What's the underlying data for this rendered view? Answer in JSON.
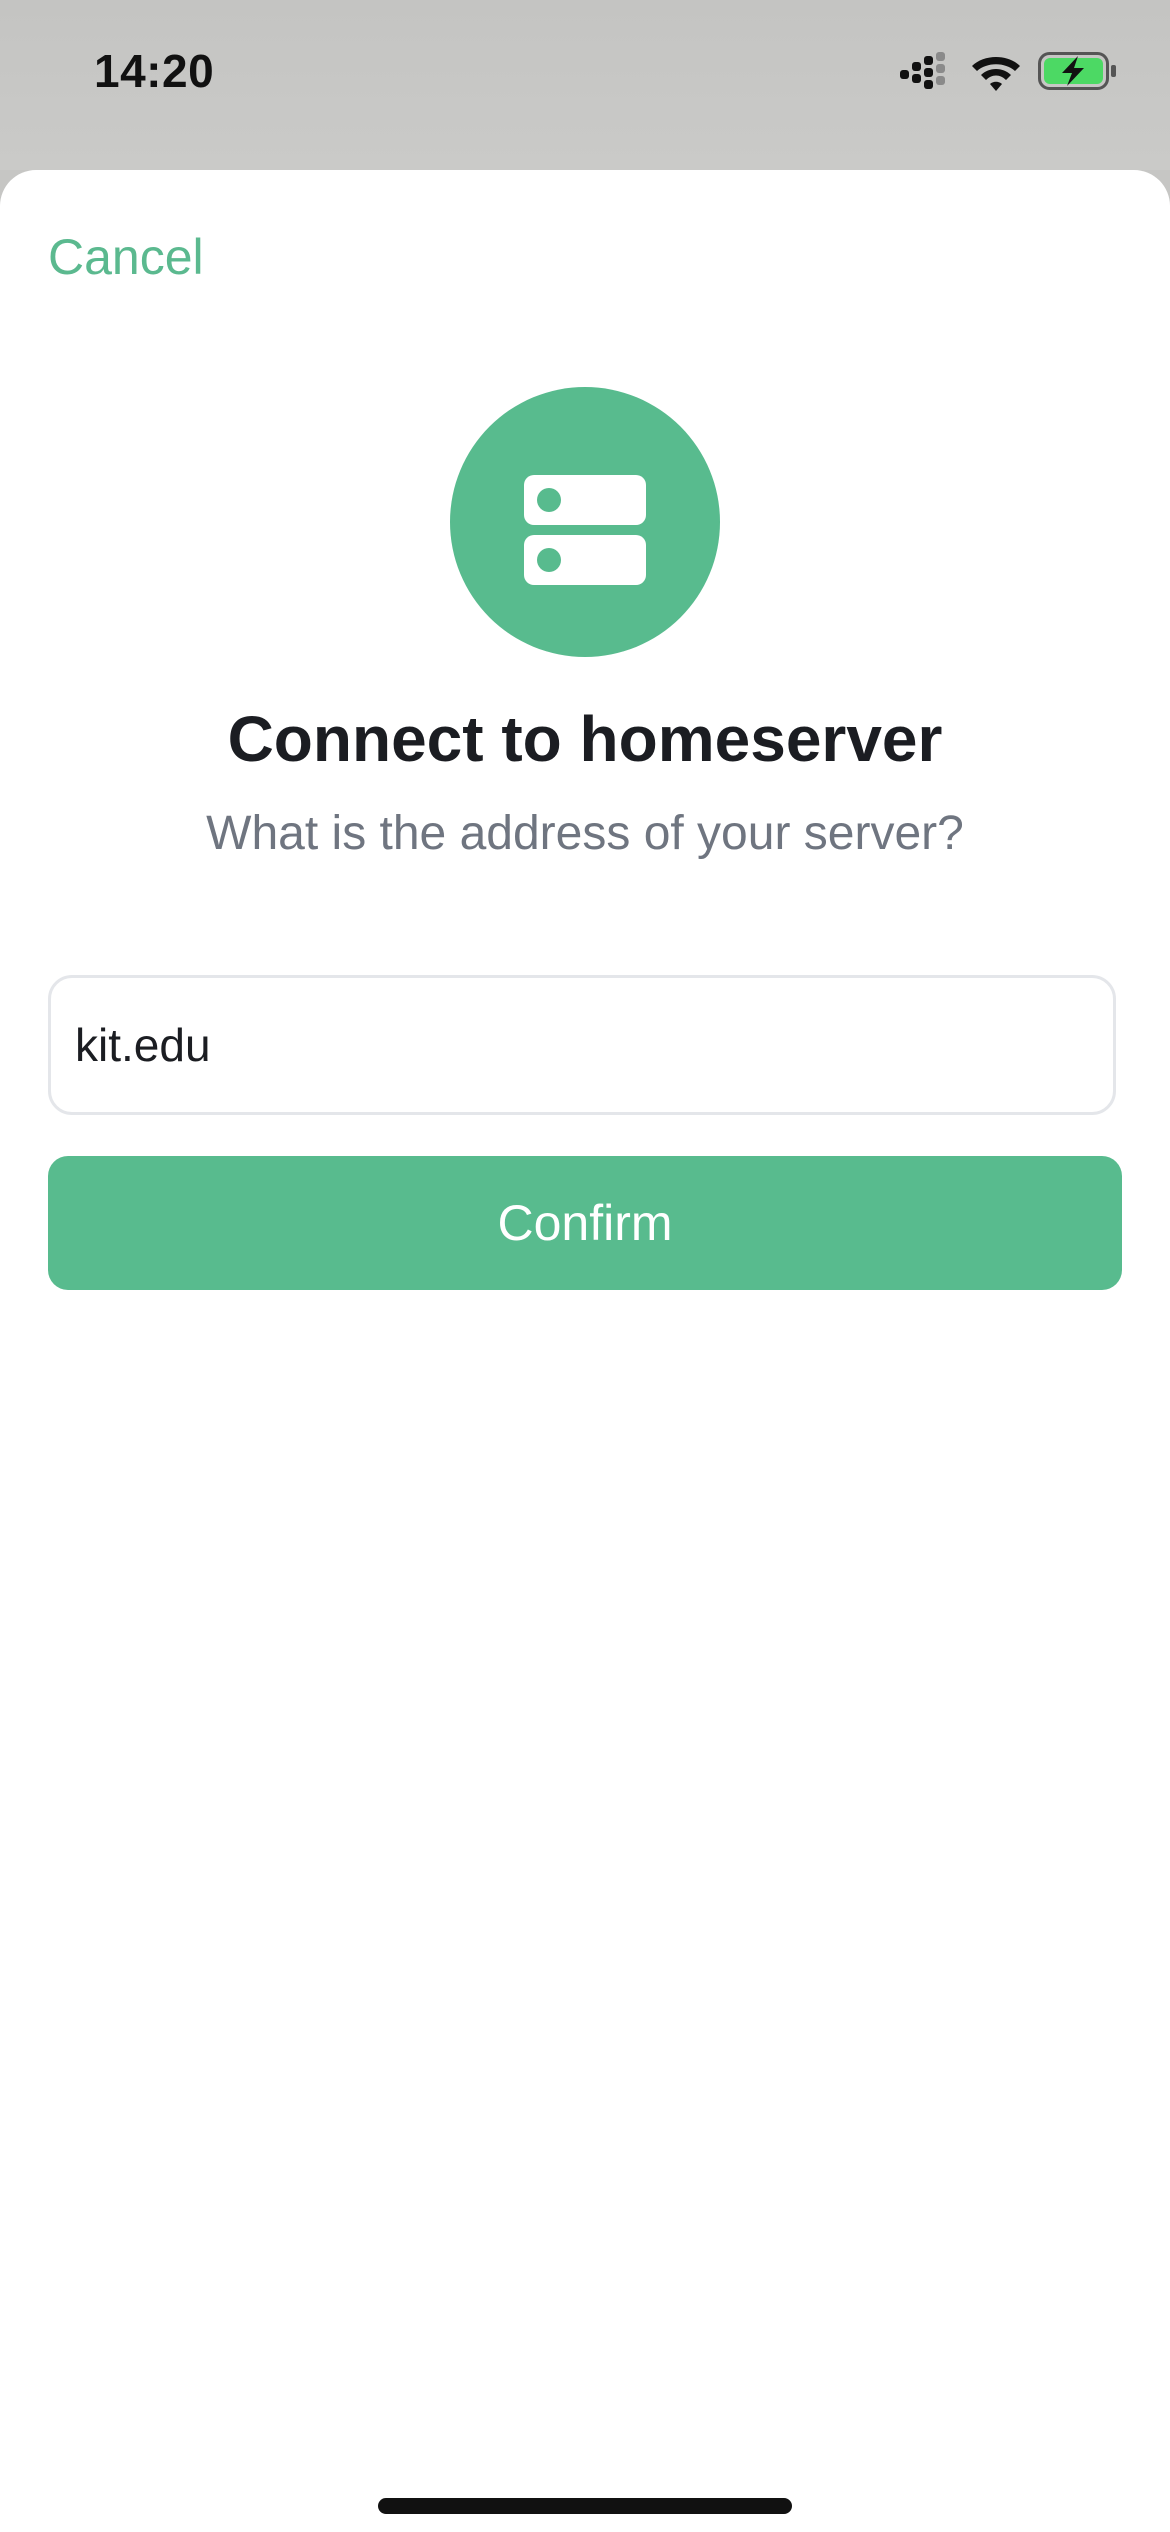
{
  "status_bar": {
    "time": "14:20",
    "icons": [
      "cellular-signal-icon",
      "wifi-icon",
      "battery-charging-icon"
    ]
  },
  "sheet": {
    "cancel_label": "Cancel",
    "badge_icon": "server-icon",
    "title": "Connect to homeserver",
    "subtitle": "What is the address of your server?",
    "server_input": {
      "value": "kit.edu"
    },
    "confirm_label": "Confirm"
  },
  "colors": {
    "accent": "#58bb8e",
    "title_text": "#1b1d22",
    "subtitle_text": "#6f7580",
    "battery_fill": "#4cd964"
  }
}
